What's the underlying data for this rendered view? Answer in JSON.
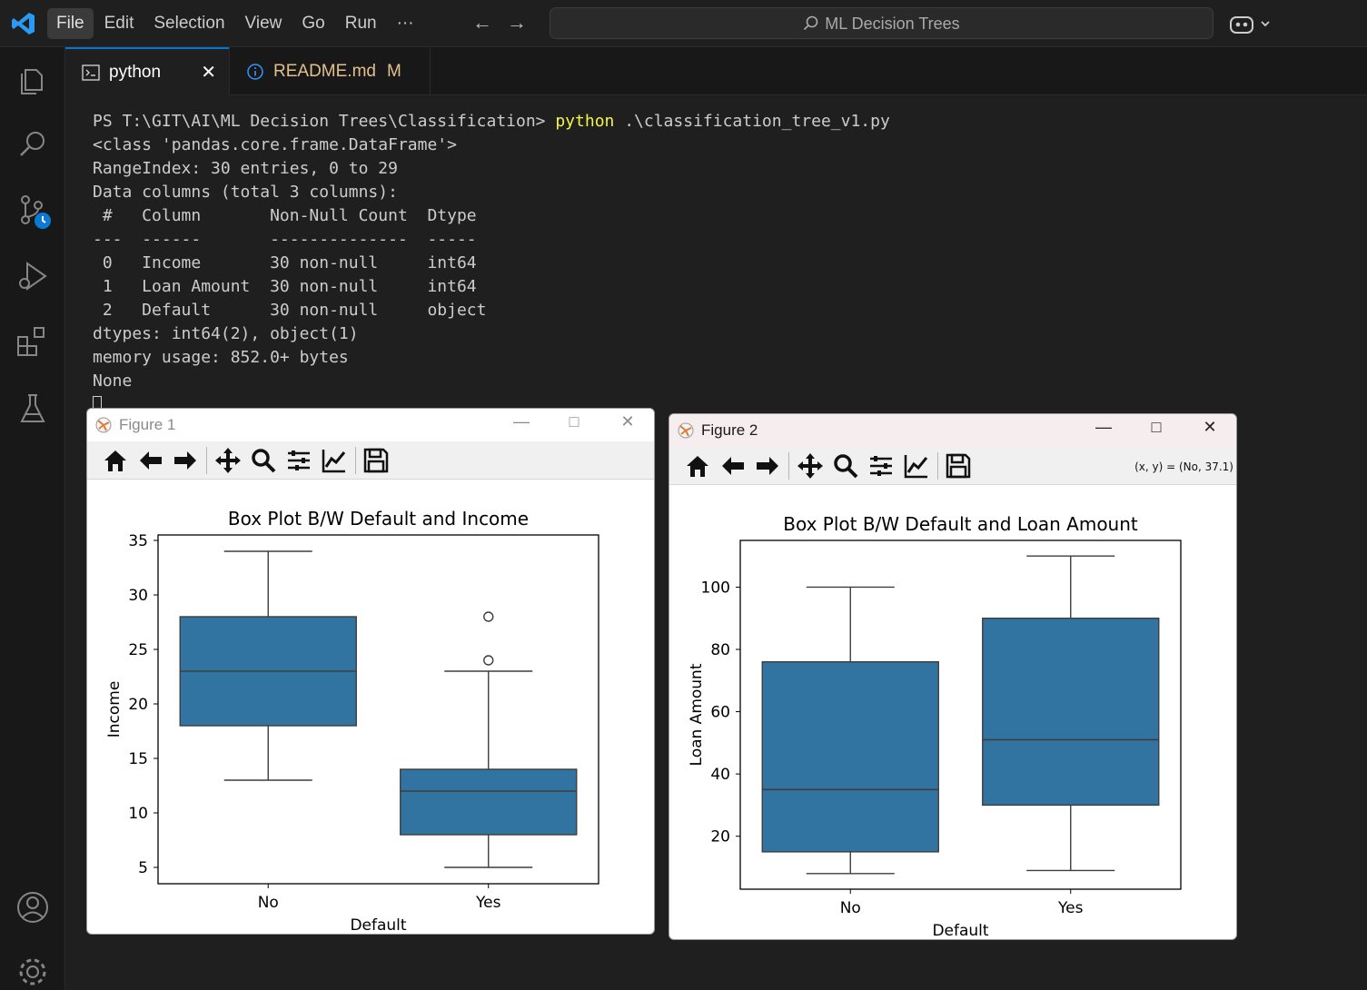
{
  "window": {
    "menu": [
      "File",
      "Edit",
      "Selection",
      "View",
      "Go",
      "Run",
      "···"
    ],
    "search_text": "ML Decision Trees"
  },
  "tabs": [
    {
      "label": "python",
      "close": "✕"
    },
    {
      "label": "README.md",
      "flag": "M"
    }
  ],
  "terminal": {
    "prompt": "PS T:\\GIT\\AI\\ML Decision Trees\\Classification> ",
    "command": "python",
    "command_args": " .\\classification_tree_v1.py",
    "output": [
      "<class 'pandas.core.frame.DataFrame'>",
      "RangeIndex: 30 entries, 0 to 29",
      "Data columns (total 3 columns):",
      " #   Column       Non-Null Count  Dtype ",
      "---  ------       --------------  ----- ",
      " 0   Income       30 non-null     int64 ",
      " 1   Loan Amount  30 non-null     int64 ",
      " 2   Default      30 non-null     object",
      "dtypes: int64(2), object(1)",
      "memory usage: 852.0+ bytes",
      "None"
    ]
  },
  "figures": [
    {
      "title": "Figure 1",
      "coords": ""
    },
    {
      "title": "Figure 2",
      "coords": "(x, y) = (No, 37.1)"
    }
  ],
  "colors": {
    "box_fill": "#3274a1",
    "line": "#3d3d3d"
  },
  "chart_data": [
    {
      "type": "box",
      "title": "Box Plot B/W Default and Income",
      "xlabel": "Default",
      "ylabel": "Income",
      "categories": [
        "No",
        "Yes"
      ],
      "yticks": [
        5,
        10,
        15,
        20,
        25,
        30,
        35
      ],
      "ylim": [
        3.5,
        35.5
      ],
      "boxes": [
        {
          "category": "No",
          "whislo": 13,
          "q1": 18,
          "med": 23,
          "q3": 28,
          "whishi": 34,
          "fliers": []
        },
        {
          "category": "Yes",
          "whislo": 5,
          "q1": 8,
          "med": 12,
          "q3": 14,
          "whishi": 23,
          "fliers": [
            24,
            28
          ]
        }
      ]
    },
    {
      "type": "box",
      "title": "Box Plot B/W Default and Loan Amount",
      "xlabel": "Default",
      "ylabel": "Loan Amount",
      "categories": [
        "No",
        "Yes"
      ],
      "yticks": [
        20,
        40,
        60,
        80,
        100
      ],
      "ylim": [
        3,
        115
      ],
      "boxes": [
        {
          "category": "No",
          "whislo": 8,
          "q1": 15,
          "med": 35,
          "q3": 76,
          "whishi": 100,
          "fliers": []
        },
        {
          "category": "Yes",
          "whislo": 9,
          "q1": 30,
          "med": 51,
          "q3": 90,
          "whishi": 110,
          "fliers": []
        }
      ]
    }
  ]
}
